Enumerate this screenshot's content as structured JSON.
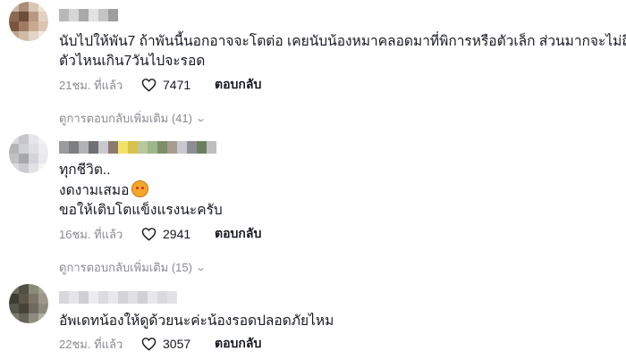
{
  "comments": [
    {
      "lines": [
        "นับไปให้พัน7 ถ้าพันนี้นอกอาจจะโตต่อ เคยนับน้องหมาคลอดมาที่พิการหรือตัวเล็ก ส่วนมากจะไม่ถึง",
        "ตัวไหนเกิน7วันไปจะรอด"
      ],
      "time": "21ชม. ที่แล้ว",
      "likes": "7471",
      "reply_label": "ตอบกลับ",
      "more_replies": "ดูการตอบกลับเพิ่มเติม (41)"
    },
    {
      "lines": [
        "ทุกชีวิต..",
        "งดงามเสมอ",
        "ขอให้เติบโตแข็งแรงนะครับ"
      ],
      "time": "16ชม. ที่แล้ว",
      "likes": "2941",
      "reply_label": "ตอบกลับ",
      "more_replies": "ดูการตอบกลับเพิ่มเติม (15)"
    },
    {
      "lines": [
        "อัพเดทน้องให้ดูด้วยนะค่ะน้องรอดปลอดภัยไหม"
      ],
      "time": "22ชม. ที่แล้ว",
      "likes": "3057",
      "reply_label": "ตอบกลับ"
    }
  ],
  "icons": {
    "like": "heart-outline-icon",
    "expand": "chevron-down-icon",
    "emoji": "smiling-face-with-hearts-emoji"
  }
}
